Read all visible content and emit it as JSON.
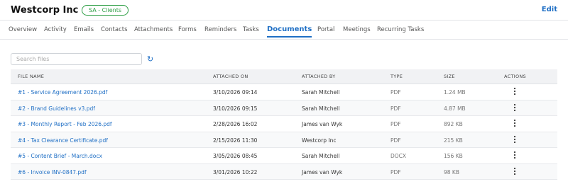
{
  "header": {
    "client_name": "Westcorp Inc",
    "badge": "SA - Clients",
    "edit_label": "Edit"
  },
  "tabs": [
    {
      "label": "Overview"
    },
    {
      "label": "Activity"
    },
    {
      "label": "Emails"
    },
    {
      "label": "Contacts"
    },
    {
      "label": "Attachments"
    },
    {
      "label": "Forms"
    },
    {
      "label": "Reminders"
    },
    {
      "label": "Tasks"
    },
    {
      "label": "Documents",
      "active": true
    },
    {
      "label": "Portal"
    },
    {
      "label": "Meetings"
    },
    {
      "label": "Recurring Tasks"
    }
  ],
  "search": {
    "placeholder": "Search files",
    "value": ""
  },
  "refresh_icon": "refresh-icon",
  "table": {
    "columns": [
      "FILE NAME",
      "ATTACHED ON",
      "ATTACHED BY",
      "TYPE",
      "SIZE",
      "ACTIONS"
    ],
    "rows": [
      {
        "file_name": "#1 - Service Agreement 2026.pdf",
        "attached_on": "3/10/2026 09:14",
        "attached_by": "Sarah Mitchell",
        "type": "PDF",
        "size": "1.24 MB"
      },
      {
        "file_name": "#2 - Brand Guidelines v3.pdf",
        "attached_on": "3/10/2026 09:15",
        "attached_by": "Sarah Mitchell",
        "type": "PDF",
        "size": "4.87 MB"
      },
      {
        "file_name": "#3 - Monthly Report - Feb 2026.pdf",
        "attached_on": "2/28/2026 16:02",
        "attached_by": "James van Wyk",
        "type": "PDF",
        "size": "892 KB"
      },
      {
        "file_name": "#4 - Tax Clearance Certificate.pdf",
        "attached_on": "2/15/2026 11:30",
        "attached_by": "Westcorp Inc",
        "type": "PDF",
        "size": "215 KB"
      },
      {
        "file_name": "#5 - Content Brief - March.docx",
        "attached_on": "3/05/2026 08:45",
        "attached_by": "Sarah Mitchell",
        "type": "DOCX",
        "size": "156 KB"
      },
      {
        "file_name": "#6 - Invoice INV-0847.pdf",
        "attached_on": "3/01/2026 10:22",
        "attached_by": "James van Wyk",
        "type": "PDF",
        "size": "98 KB"
      }
    ]
  },
  "colors": {
    "accent": "#1f6fc5",
    "badge_green": "#2e9e45"
  }
}
